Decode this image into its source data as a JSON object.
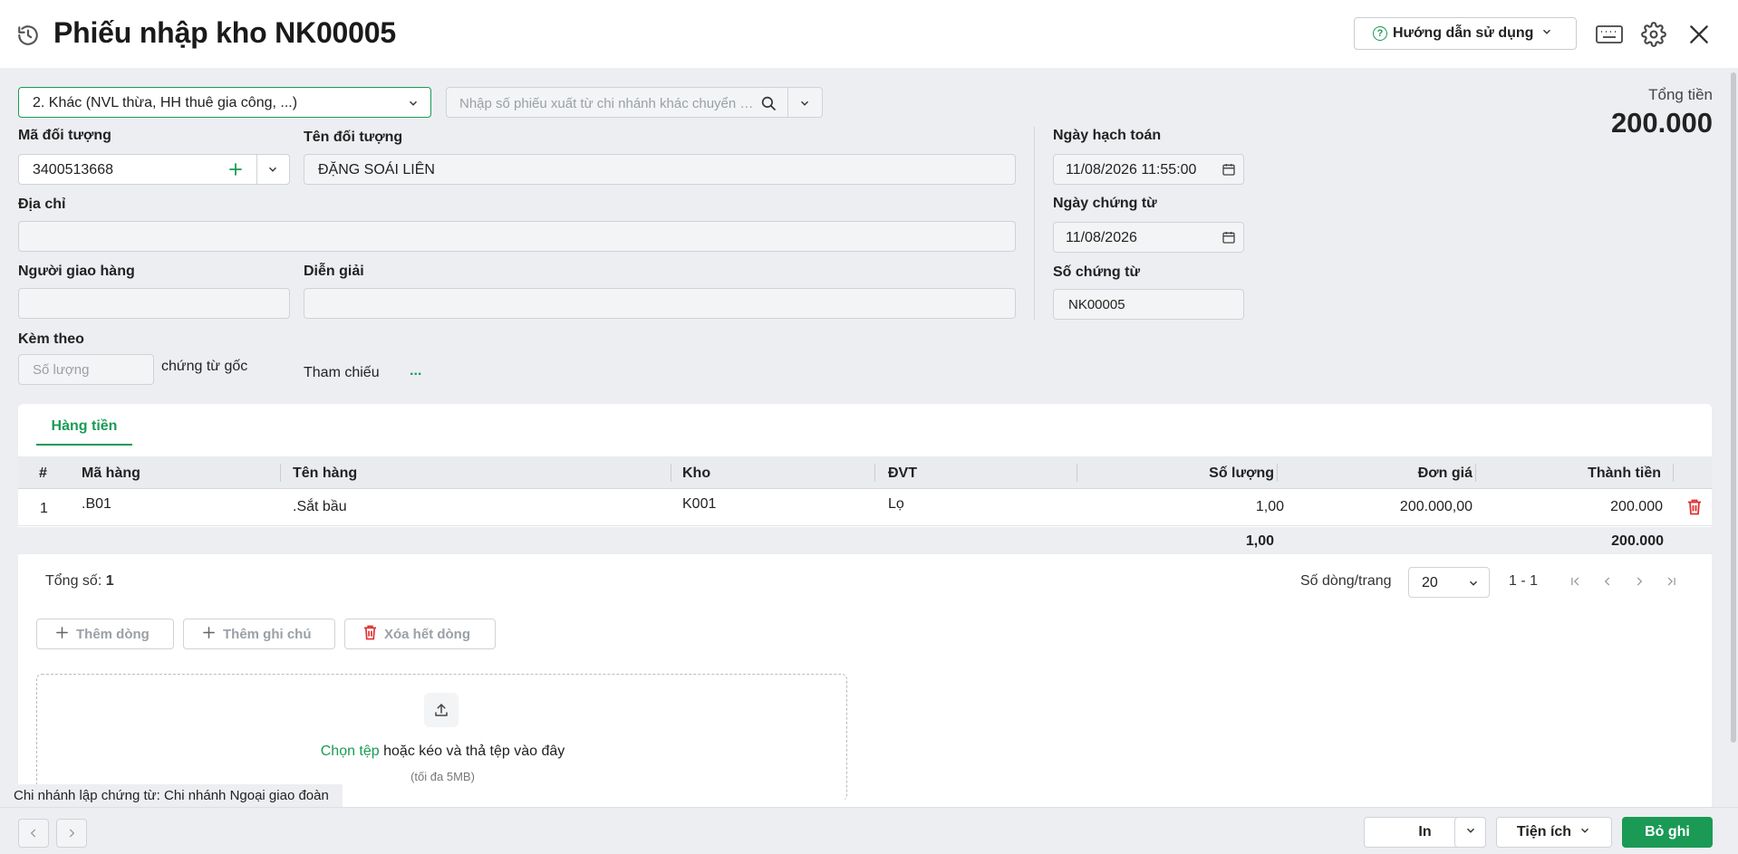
{
  "header": {
    "title": "Phiếu nhập kho NK00005",
    "guide_label": "Hướng dẫn sử dụng"
  },
  "form": {
    "type_select": "2. Khác (NVL thừa, HH thuê gia công, ...)",
    "search_placeholder": "Nhập số phiếu xuất từ chi nhánh khác chuyển đến",
    "ma_doi_tuong_label": "Mã đối tượng",
    "ma_doi_tuong_value": "3400513668",
    "ten_doi_tuong_label": "Tên đối tượng",
    "ten_doi_tuong_value": "ĐẶNG SOÁI LIÊN",
    "dia_chi_label": "Địa chỉ",
    "dia_chi_value": "",
    "nguoi_giao_label": "Người giao hàng",
    "nguoi_giao_value": "",
    "dien_giai_label": "Diễn giải",
    "dien_giai_value": "",
    "kem_theo_label": "Kèm theo",
    "so_luong_placeholder": "Số lượng",
    "chung_tu_goc_label": "chứng từ gốc",
    "tham_chieu_label": "Tham chiếu",
    "tham_chieu_more": "...",
    "ngay_hach_toan_label": "Ngày hạch toán",
    "ngay_hach_toan_value": "11/08/2026 11:55:00",
    "ngay_chung_tu_label": "Ngày chứng từ",
    "ngay_chung_tu_value": "11/08/2026",
    "so_chung_tu_label": "Số chứng từ",
    "so_chung_tu_value": "NK00005"
  },
  "total": {
    "label": "Tổng tiền",
    "value": "200.000"
  },
  "detail": {
    "tab_label": "Hàng tiền",
    "columns": [
      "#",
      "Mã hàng",
      "Tên hàng",
      "Kho",
      "ĐVT",
      "Số lượng",
      "Đơn giá",
      "Thành tiền"
    ],
    "rows": [
      {
        "idx": "1",
        "ma_hang": ".B01",
        "ten_hang": ".Sắt bầu",
        "kho": "K001",
        "dvt": "Lọ",
        "so_luong": "1,00",
        "don_gia": "200.000,00",
        "thanh_tien": "200.000"
      }
    ],
    "sum_so_luong": "1,00",
    "sum_thanh_tien": "200.000",
    "total_count_label": "Tổng số:",
    "total_count_value": "1",
    "rows_per_page_label": "Số dòng/trang",
    "rows_per_page_value": "20",
    "range": "1 - 1",
    "add_row": "Thêm dòng",
    "add_note": "Thêm ghi chú",
    "delete_all": "Xóa hết dòng"
  },
  "upload": {
    "choose": "Chọn tệp",
    "rest": " hoặc kéo và thả tệp vào đây",
    "note": "(tối đa 5MB)"
  },
  "branch_text": "Chi nhánh lập chứng từ: Chi nhánh Ngoại giao đoàn",
  "bottom": {
    "print": "In",
    "utility": "Tiện ích",
    "save": "Bỏ ghi"
  },
  "colors": {
    "accent": "#1a9a55",
    "delete": "#e03131"
  }
}
